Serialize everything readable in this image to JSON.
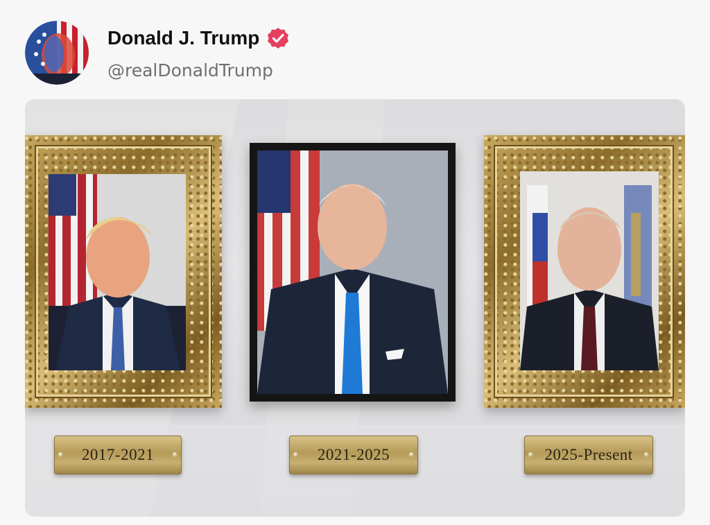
{
  "post": {
    "author": {
      "display_name": "Donald J. Trump",
      "handle": "@realDonaldTrump",
      "verified": true,
      "verified_badge_color": "#e4405f"
    }
  },
  "media": {
    "plaques": [
      {
        "label": "2017-2021"
      },
      {
        "label": "2021-2025"
      },
      {
        "label": "2025-Present"
      }
    ]
  }
}
